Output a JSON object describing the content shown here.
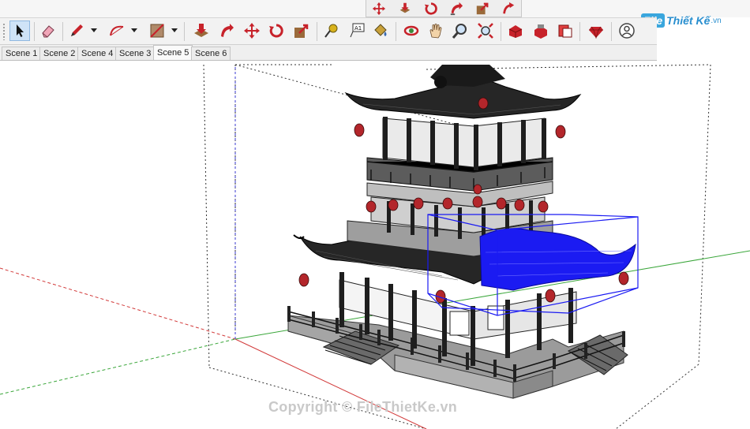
{
  "app": {
    "logo": {
      "badge": "File",
      "name": "Thiết Kế",
      "tld": ".vn"
    }
  },
  "floating_toolbar": {
    "icons": [
      "move-icon",
      "push-pull-icon",
      "rotate-icon",
      "follow-me-icon",
      "scale-icon",
      "offset-icon"
    ]
  },
  "toolbar": {
    "tools": [
      {
        "name": "select-tool-button",
        "icon": "arrow-cursor-icon",
        "active": true
      },
      {
        "name": "eraser-tool-button",
        "icon": "eraser-icon",
        "active": false
      },
      {
        "name": "pencil-line-tool-button",
        "icon": "pencil-icon",
        "active": false,
        "dropdown": true
      },
      {
        "name": "arc-tool-button",
        "icon": "arc-icon",
        "active": false,
        "dropdown": true
      },
      {
        "name": "rectangle-tool-button",
        "icon": "rectangle-icon",
        "active": false,
        "dropdown": true
      },
      {
        "name": "push-pull-tool-button",
        "icon": "push-pull-icon",
        "active": false
      },
      {
        "name": "follow-me-tool-button",
        "icon": "follow-me-icon",
        "active": false
      },
      {
        "name": "move-tool-button",
        "icon": "move-icon",
        "active": false
      },
      {
        "name": "rotate-tool-button",
        "icon": "rotate-icon",
        "active": false
      },
      {
        "name": "scale-tool-button",
        "icon": "scale-icon",
        "active": false
      },
      {
        "name": "tape-measure-tool-button",
        "icon": "tape-measure-icon",
        "active": false
      },
      {
        "name": "text-tool-button",
        "icon": "text-a1-icon",
        "active": false
      },
      {
        "name": "paint-bucket-tool-button",
        "icon": "paint-bucket-icon",
        "active": false
      },
      {
        "name": "orbit-tool-button",
        "icon": "orbit-icon",
        "active": false
      },
      {
        "name": "pan-tool-button",
        "icon": "hand-icon",
        "active": false
      },
      {
        "name": "zoom-tool-button",
        "icon": "magnifier-icon",
        "active": false
      },
      {
        "name": "zoom-extents-tool-button",
        "icon": "zoom-extents-icon",
        "active": false
      },
      {
        "name": "warehouse-button",
        "icon": "warehouse-icon",
        "active": false
      },
      {
        "name": "extension-warehouse-button",
        "icon": "extension-icon",
        "active": false
      },
      {
        "name": "send-to-layout-button",
        "icon": "layout-icon",
        "active": false
      },
      {
        "name": "ruby-console-button",
        "icon": "ruby-icon",
        "active": false
      },
      {
        "name": "account-button",
        "icon": "user-icon",
        "active": false
      }
    ]
  },
  "scenes": {
    "tabs": [
      {
        "label": "Scene 1",
        "active": false
      },
      {
        "label": "Scene 2",
        "active": false
      },
      {
        "label": "Scene 4",
        "active": false
      },
      {
        "label": "Scene 3",
        "active": false
      },
      {
        "label": "Scene 5",
        "active": true
      },
      {
        "label": "Scene 6",
        "active": false
      }
    ]
  },
  "viewport": {
    "watermark": "Copyright © FileThietKe.vn",
    "colors": {
      "selection": "#1b1bf2",
      "axis_red": "#d23a3a",
      "axis_green": "#3aa63a",
      "axis_blue": "#3a3ad2",
      "model_dark": "#2a2a2a",
      "lantern": "#b3262b",
      "stone": "#8c8c8c"
    }
  }
}
